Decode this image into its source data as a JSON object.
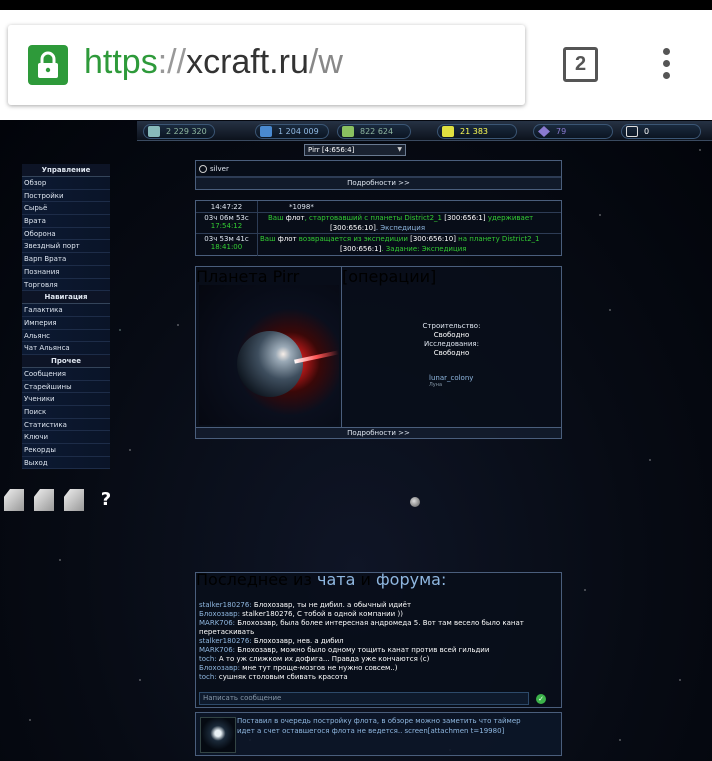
{
  "browser": {
    "url_scheme": "https",
    "url_separator": "://",
    "url_host": "xcraft.ru",
    "url_path": "/w",
    "tab_count": "2"
  },
  "resources": [
    {
      "value": "2 229 320",
      "color": "#8fb7a0",
      "icon": "metal-icon"
    },
    {
      "value": "1 204 009",
      "color": "#8fb7e0",
      "icon": "crystal-icon"
    },
    {
      "value": "822 624",
      "color": "#8fb7a0",
      "icon": "deuterium-icon"
    },
    {
      "value": "21 383",
      "color": "#ffff55",
      "icon": "energy-icon"
    },
    {
      "value": "79",
      "color": "#8a7ad0",
      "icon": "dark-matter-icon"
    },
    {
      "value": "0",
      "color": "#ffffff",
      "icon": "mail-icon"
    }
  ],
  "planet_selector": {
    "label": "Pirr [4:656:4]"
  },
  "sidebar": {
    "sections": [
      {
        "title": "Управление",
        "items": [
          "Обзор",
          "Постройки",
          "Сырьё",
          "Врата",
          "Оборона",
          "Звездный порт",
          "Варп Врата",
          "Познания",
          "Торговля"
        ]
      },
      {
        "title": "Навигация",
        "items": [
          "Галактика",
          "Империя",
          "Альянс",
          "Чат Альянса"
        ]
      },
      {
        "title": "Прочее",
        "items": [
          "Сообщения",
          "Старейшины",
          "Ученики",
          "Поиск",
          "Статистика",
          "Ключи",
          "Рекорды",
          "Выход"
        ]
      }
    ]
  },
  "user_panel": {
    "name": "silver",
    "details": "Подробности >>"
  },
  "events": {
    "server_time": "14:47:22",
    "server_id": "*1098*",
    "rows": [
      {
        "countdown": "03ч 06м 53с",
        "time": "17:54:12",
        "p1": "Ваш",
        "p2": "флот",
        "p3": ", стартовавший с планеты District2_1",
        "p4": "[300:656:1]",
        "p5": "удерживает",
        "p6": "[300:656:10]",
        "p7": ". Экспедиция"
      },
      {
        "countdown": "03ч 53м 41с",
        "time": "18:41:00",
        "p1": "Ваш",
        "p2": "флот",
        "p3": "возвращается из экспедиции",
        "p4": "[300:656:10]",
        "p5": "на планету District2_1",
        "p6": "[300:656:1]",
        "p7": ". Задание: Экспедиция"
      }
    ]
  },
  "planet": {
    "header": "Планета Pirr",
    "ops_header": "[операции]",
    "build_label": "Строительство:",
    "build_value": "Свободно",
    "research_label": "Исследования:",
    "research_value": "Свободно",
    "moon_name": "lunar_colony",
    "moon_type": "Луна",
    "details": "Подробности >>"
  },
  "chat": {
    "header_prefix": "Последнее из",
    "header_chat": "чата",
    "header_and": "и",
    "header_forum": "форума:",
    "messages": [
      {
        "name": "stalker180276:",
        "text": " Блохозавр, ты не дибил. а обычный идиёт"
      },
      {
        "name": "Блохозавр:",
        "text": " stalker180276, С тобой в одной компании ))"
      },
      {
        "name": "MARK706:",
        "text": " Блохозавр, была более интересная андромеда 5. Вот там весело было канат"
      },
      {
        "name": "",
        "text": "перетаскивать"
      },
      {
        "name": "stalker180276:",
        "text": " Блохозавр, нев. а дибил"
      },
      {
        "name": "MARK706:",
        "text": " Блохозавр, можно было одному тощить канат против всей гильдии"
      },
      {
        "name": "toch:",
        "text": " А то уж слижком их дофига... Правда уже кончаются (с)"
      },
      {
        "name": "Блохозавр:",
        "text": " мне тут проще-мозгов не нужно совсем..)"
      },
      {
        "name": "toch:",
        "text": " сушняк столовым сбивать красота"
      }
    ],
    "input_placeholder": "Написать сообщение",
    "send_icon": "check-icon"
  },
  "forum": {
    "line1": "Поставил в очередь постройку флота, в обзоре можно заметить что таймер",
    "line2": "идет а счет оставшегося флота не ведется.. screen[attachmen t=19980]"
  },
  "colors": {
    "accent_green": "#33cc33",
    "link_blue": "#8fb7e0",
    "panel_border": "#4a5e7c"
  }
}
